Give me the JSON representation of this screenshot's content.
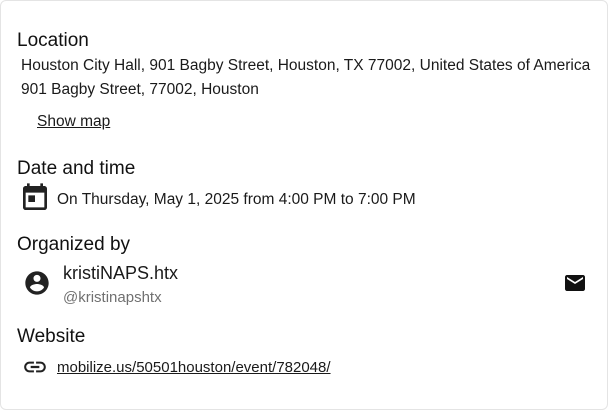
{
  "location": {
    "heading": "Location",
    "address_full": "Houston City Hall, 901 Bagby Street, Houston, TX 77002, United States of America",
    "address_short": "901 Bagby Street, 77002, Houston",
    "show_map_label": "Show map"
  },
  "datetime": {
    "heading": "Date and time",
    "text": "On Thursday, May 1, 2025 from 4:00 PM to 7:00 PM",
    "icon": "calendar-icon"
  },
  "organizer": {
    "heading": "Organized by",
    "name": "kristiNAPS.htx",
    "handle": "@kristinapshtx",
    "avatar_icon": "account-circle-icon",
    "contact_icon": "mail-icon"
  },
  "website": {
    "heading": "Website",
    "url": "mobilize.us/50501houston/event/782048/",
    "icon": "link-icon"
  }
}
